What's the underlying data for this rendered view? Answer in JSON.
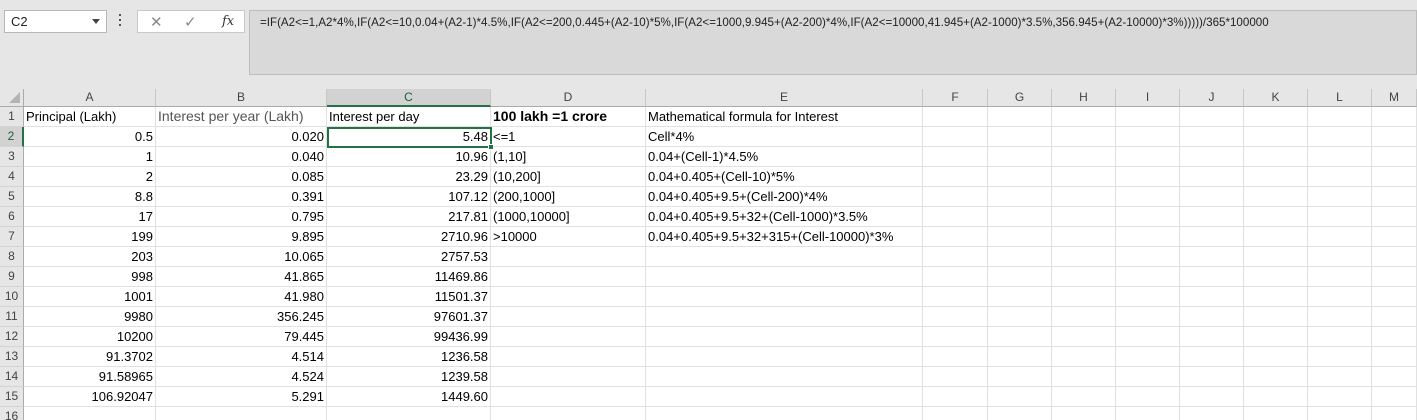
{
  "name_box": "C2",
  "formula": "=IF(A2<=1,A2*4%,IF(A2<=10,0.04+(A2-1)*4.5%,IF(A2<=200,0.445+(A2-10)*5%,IF(A2<=1000,9.945+(A2-200)*4%,IF(A2<=10000,41.945+(A2-1000)*3.5%,356.945+(A2-10000)*3%)))))/365*100000",
  "icons": {
    "cancel": "✕",
    "enter": "✓",
    "fx": "fx"
  },
  "columns": [
    "A",
    "B",
    "C",
    "D",
    "E",
    "F",
    "G",
    "H",
    "I",
    "J",
    "K",
    "L",
    "M"
  ],
  "rows": [
    "1",
    "2",
    "3",
    "4",
    "5",
    "6",
    "7",
    "8",
    "9",
    "10",
    "11",
    "12",
    "13",
    "14",
    "15",
    "16"
  ],
  "headers": {
    "a": "Principal (Lakh)",
    "b": "Interest per year (Lakh)",
    "c": "Interest per day",
    "d": "100 lakh =1 crore",
    "e": "Mathematical formula for Interest"
  },
  "table": [
    {
      "a": "0.5",
      "b": "0.020",
      "c": "5.48",
      "d": "<=1",
      "e": "Cell*4%"
    },
    {
      "a": "1",
      "b": "0.040",
      "c": "10.96",
      "d": "(1,10]",
      "e": "0.04+(Cell-1)*4.5%"
    },
    {
      "a": "2",
      "b": "0.085",
      "c": "23.29",
      "d": "(10,200]",
      "e": "0.04+0.405+(Cell-10)*5%"
    },
    {
      "a": "8.8",
      "b": "0.391",
      "c": "107.12",
      "d": "(200,1000]",
      "e": "0.04+0.405+9.5+(Cell-200)*4%"
    },
    {
      "a": "17",
      "b": "0.795",
      "c": "217.81",
      "d": "(1000,10000]",
      "e": "0.04+0.405+9.5+32+(Cell-1000)*3.5%"
    },
    {
      "a": "199",
      "b": "9.895",
      "c": "2710.96",
      "d": ">10000",
      "e": "0.04+0.405+9.5+32+315+(Cell-10000)*3%"
    },
    {
      "a": "203",
      "b": "10.065",
      "c": "2757.53",
      "d": "",
      "e": ""
    },
    {
      "a": "998",
      "b": "41.865",
      "c": "11469.86",
      "d": "",
      "e": ""
    },
    {
      "a": "1001",
      "b": "41.980",
      "c": "11501.37",
      "d": "",
      "e": ""
    },
    {
      "a": "9980",
      "b": "356.245",
      "c": "97601.37",
      "d": "",
      "e": ""
    },
    {
      "a": "10200",
      "b": "79.445",
      "c": "99436.99",
      "d": "",
      "e": ""
    },
    {
      "a": "91.3702",
      "b": "4.514",
      "c": "1236.58",
      "d": "",
      "e": ""
    },
    {
      "a": "91.58965",
      "b": "4.524",
      "c": "1239.58",
      "d": "",
      "e": ""
    },
    {
      "a": "106.92047",
      "b": "5.291",
      "c": "1449.60",
      "d": "",
      "e": ""
    }
  ],
  "colors": {
    "accent": "#217346",
    "header_bg": "#e6e6e6",
    "selected_header_bg": "#d2d2d2"
  }
}
